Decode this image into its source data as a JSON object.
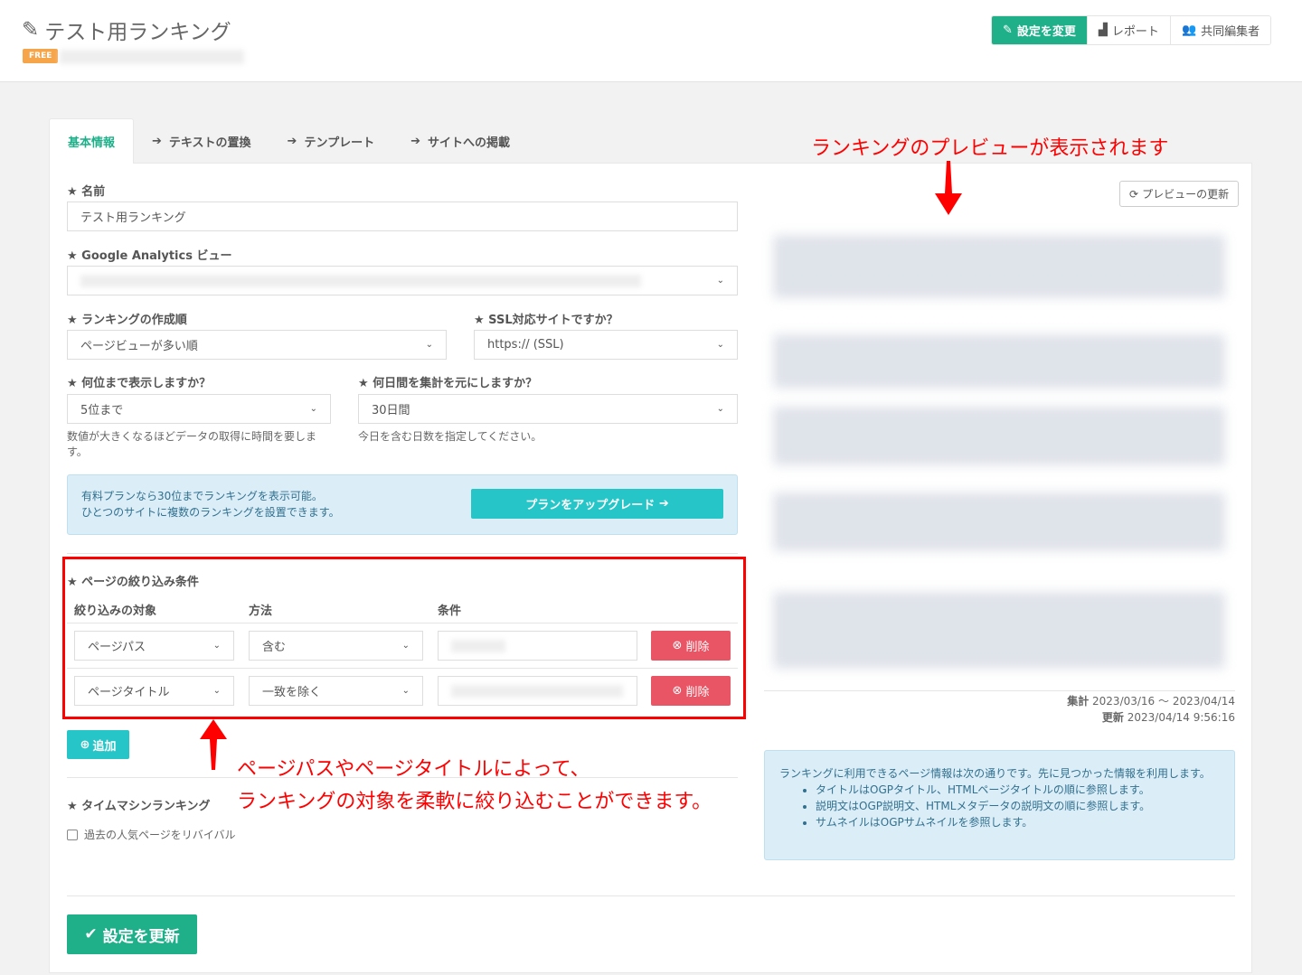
{
  "header": {
    "title": "テスト用ランキング",
    "plan_badge": "FREE",
    "buttons": {
      "settings": "設定を変更",
      "report": "レポート",
      "collaborators": "共同編集者"
    }
  },
  "tabs": [
    {
      "label": "基本情報"
    },
    {
      "label": "テキストの置換"
    },
    {
      "label": "テンプレート"
    },
    {
      "label": "サイトへの掲載"
    }
  ],
  "form": {
    "name_label": "★ 名前",
    "name_value": "テスト用ランキング",
    "ga_label": "★ Google Analytics ビュー",
    "order_label": "★ ランキングの作成順",
    "order_value": "ページビューが多い順",
    "ssl_label": "★ SSL対応サイトですか？",
    "ssl_value": "https:// (SSL)",
    "count_label": "★ 何位まで表示しますか？",
    "count_value": "5位まで",
    "count_help": "数値が大きくなるほどデータの取得に時間を要します。",
    "days_label": "★ 何日間を集計を元にしますか？",
    "days_value": "30日間",
    "days_help": "今日を含む日数を指定してください。",
    "upgrade_text1": "有料プランなら30位までランキングを表示可能。",
    "upgrade_text2": "ひとつのサイトに複数のランキングを設置できます。",
    "upgrade_button": "プランをアップグレード",
    "filter_label": "★ ページの絞り込み条件",
    "filter_headers": [
      "絞り込みの対象",
      "方法",
      "条件"
    ],
    "filters": [
      {
        "target": "ページパス",
        "method": "含む",
        "delete": "削除"
      },
      {
        "target": "ページタイトル",
        "method": "一致を除く",
        "delete": "削除"
      }
    ],
    "add_button": "追加",
    "timemachine_label": "★ タイムマシンランキング",
    "timemachine_checkbox": "過去の人気ページをリバイバル",
    "save_button": "設定を更新"
  },
  "preview": {
    "refresh_button": "プレビューの更新",
    "period_label": "集計",
    "period_value": "2023/03/16 〜 2023/04/14",
    "updated_label": "更新",
    "updated_value": "2023/04/14 9:56:16",
    "info_text": "ランキングに利用できるページ情報は次の通りです。先に見つかった情報を利用します。",
    "info_items": [
      "タイトルはOGPタイトル、HTMLページタイトルの順に参照します。",
      "説明文はOGP説明文、HTMLメタデータの説明文の順に参照します。",
      "サムネイルはOGPサムネイルを参照します。"
    ]
  },
  "annotations": {
    "preview_note": "ランキングのプレビューが表示されます",
    "filter_note1": "ページパスやページタイトルによって、",
    "filter_note2": "ランキングの対象を柔軟に絞り込むことができます。"
  }
}
